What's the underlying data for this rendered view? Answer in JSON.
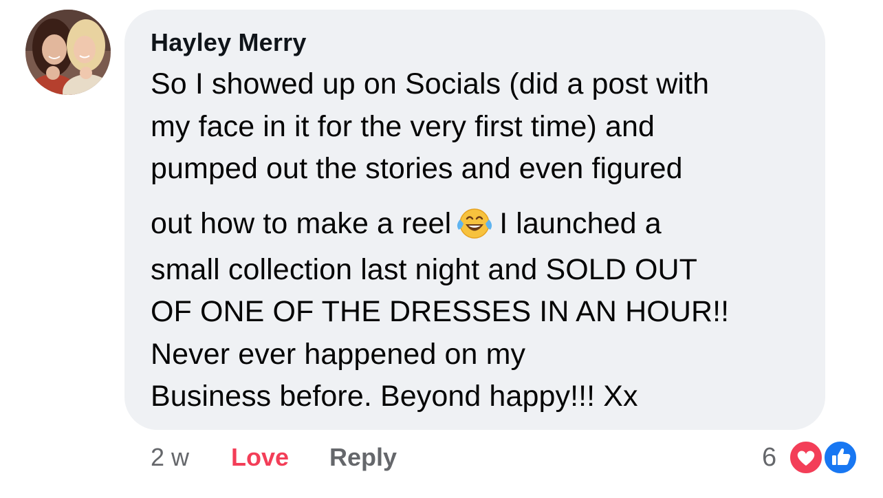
{
  "comment": {
    "author": "Hayley Merry",
    "lines": [
      "So I showed up on Socials (did a post with",
      "my face in it for the very first time) and",
      "pumped out the stories and even figured",
      "out how to make a reel",
      "I launched a",
      "small collection last night and SOLD OUT",
      "OF ONE OF THE DRESSES IN AN HOUR!!",
      "Never ever happened on my",
      "Business before. Beyond happy!!! Xx"
    ],
    "inline_emoji": "laughing-with-tears-emoji"
  },
  "actions": {
    "time": "2 w",
    "love_label": "Love",
    "reply_label": "Reply"
  },
  "reactions": {
    "count": "6",
    "icons": [
      "love-reaction-icon",
      "like-reaction-icon"
    ],
    "love_color": "#f33e58",
    "like_color": "#1877f2"
  },
  "colors": {
    "bubble": "#eff1f4",
    "text": "#050505",
    "secondary": "#65676b"
  }
}
